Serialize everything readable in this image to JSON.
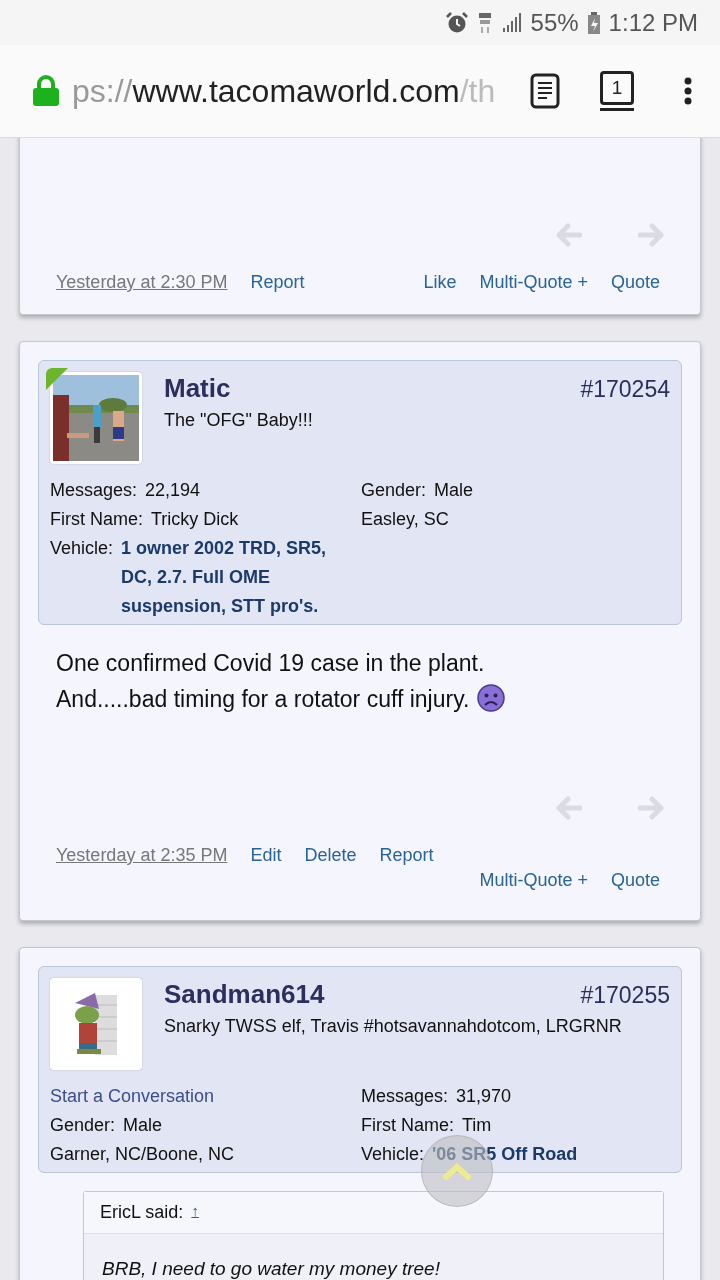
{
  "status_bar": {
    "battery": "55%",
    "time": "1:12 PM"
  },
  "address_bar": {
    "url_start": "ps://",
    "url_host": "www.tacomaworld.com",
    "url_end": "/th",
    "tab_count": "1"
  },
  "posts": [
    {
      "kind": "tail",
      "footer": {
        "date": "Yesterday at 2:30 PM",
        "links": [
          "Report"
        ],
        "actions": [
          "Like",
          "Multi-Quote +",
          "Quote"
        ]
      }
    },
    {
      "kind": "full",
      "user": {
        "name": "Matic",
        "title": "The \"OFG\" Baby!!!",
        "number": "#170254",
        "online": true,
        "left": [
          {
            "kind": "stat",
            "label": "Messages:",
            "value": "22,194"
          },
          {
            "kind": "stat",
            "label": "First Name:",
            "value": "Tricky Dick"
          },
          {
            "kind": "vehicle",
            "label": "Vehicle:",
            "value": "1 owner 2002 TRD, SR5, DC, 2.7. Full OME suspension, STT pro's."
          }
        ],
        "right": [
          {
            "kind": "stat",
            "label": "Gender:",
            "value": "Male"
          },
          {
            "kind": "plain",
            "value": "Easley, SC"
          }
        ]
      },
      "body": {
        "lines": [
          "One confirmed Covid 19 case in the plant.",
          "And.....bad timing for a rotator cuff injury."
        ],
        "trailing_emoji": {
          "kind": "sad-face"
        }
      },
      "footer": {
        "date": "Yesterday at 2:35 PM",
        "links": [
          "Edit",
          "Delete",
          "Report"
        ],
        "actions": [
          "Multi-Quote +",
          "Quote"
        ]
      }
    },
    {
      "kind": "head",
      "user": {
        "name": "Sandman614",
        "title": "Snarky TWSS elf, Travis #hotsavannahdotcom, LRGRNR",
        "number": "#170255",
        "online": false,
        "left": [
          {
            "kind": "link",
            "value": "Start a Conversation"
          },
          {
            "kind": "stat",
            "label": "Gender:",
            "value": "Male"
          },
          {
            "kind": "plain",
            "value": "Garner, NC/Boone, NC"
          }
        ],
        "right": [
          {
            "kind": "stat",
            "label": "Messages:",
            "value": "31,970"
          },
          {
            "kind": "stat",
            "label": "First Name:",
            "value": "Tim"
          },
          {
            "kind": "vehicle",
            "label": "Vehicle:",
            "value": "'06 SR5 Off Road"
          }
        ]
      },
      "quote": {
        "author": "EricL said:",
        "jump": "↑",
        "text": "BRB, I need to go water my money tree!"
      }
    }
  ]
}
